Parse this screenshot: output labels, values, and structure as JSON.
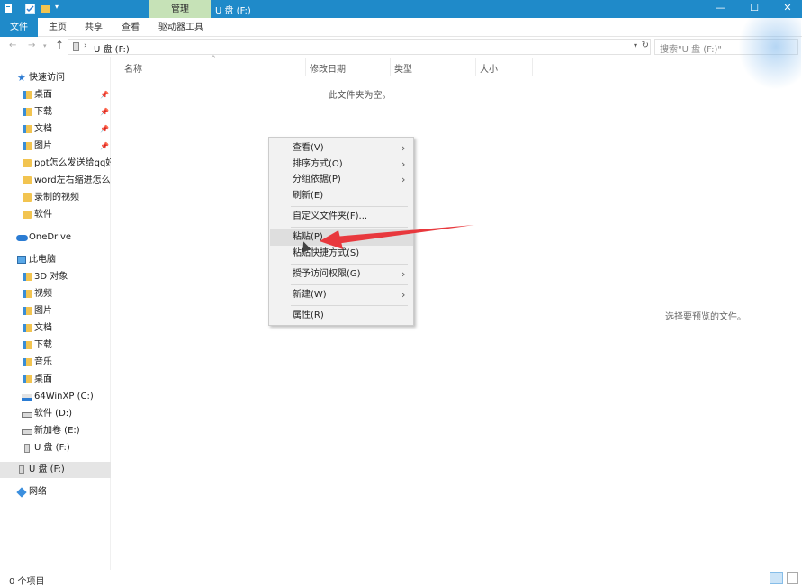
{
  "titlebar": {
    "manage_tab": "管理",
    "title": "U 盘 (F:)",
    "minimize": "—",
    "maximize": "☐",
    "close": "✕",
    "quick_access_dropdown": "▾"
  },
  "ribbon": {
    "tabs": [
      "文件",
      "主页",
      "共享",
      "查看",
      "驱动器工具"
    ]
  },
  "address": {
    "back": "←",
    "forward": "→",
    "history": "▾",
    "up": "↑",
    "chevron": "›",
    "path": "U 盘 (F:)",
    "dropdown": "▾",
    "refresh": "↻",
    "search_placeholder": "搜索\"U 盘 (F:)\""
  },
  "nav": {
    "items": [
      {
        "label": "快速访问",
        "icon": "star-icon"
      },
      {
        "label": "桌面",
        "icon": "folder-blue-icon",
        "pinned": "📌"
      },
      {
        "label": "下载",
        "icon": "download-folder-icon",
        "pinned": "📌"
      },
      {
        "label": "文档",
        "icon": "documents-folder-icon",
        "pinned": "📌"
      },
      {
        "label": "图片",
        "icon": "pictures-folder-icon",
        "pinned": "📌"
      },
      {
        "label": "ppt怎么发送给qq好",
        "icon": "folder-icon"
      },
      {
        "label": "word左右缩进怎么设",
        "icon": "folder-icon"
      },
      {
        "label": "录制的视频",
        "icon": "folder-icon"
      },
      {
        "label": "软件",
        "icon": "folder-icon"
      },
      {
        "label": "OneDrive",
        "icon": "cloud-icon"
      },
      {
        "label": "此电脑",
        "icon": "pc-icon"
      },
      {
        "label": "3D 对象",
        "icon": "3d-objects-icon"
      },
      {
        "label": "视频",
        "icon": "videos-folder-icon"
      },
      {
        "label": "图片",
        "icon": "pictures-folder-icon"
      },
      {
        "label": "文档",
        "icon": "documents-folder-icon"
      },
      {
        "label": "下载",
        "icon": "download-folder-icon"
      },
      {
        "label": "音乐",
        "icon": "music-folder-icon"
      },
      {
        "label": "桌面",
        "icon": "desktop-folder-icon"
      },
      {
        "label": "64WinXP  (C:)",
        "icon": "system-drive-icon"
      },
      {
        "label": "软件 (D:)",
        "icon": "drive-icon"
      },
      {
        "label": "新加卷 (E:)",
        "icon": "drive-icon"
      },
      {
        "label": "U 盘 (F:)",
        "icon": "usb-drive-icon"
      },
      {
        "label": "U 盘 (F:)",
        "icon": "usb-drive-icon"
      },
      {
        "label": "网络",
        "icon": "network-icon"
      }
    ]
  },
  "filelist": {
    "columns": [
      "名称",
      "修改日期",
      "类型",
      "大小"
    ],
    "sort_arrow": "^",
    "empty_message": "此文件夹为空。"
  },
  "preview": {
    "message": "选择要预览的文件。"
  },
  "status": {
    "item_count": "0 个项目"
  },
  "context_menu": {
    "items": [
      {
        "label": "查看(V)",
        "submenu": "›"
      },
      {
        "label": "排序方式(O)",
        "submenu": "›"
      },
      {
        "label": "分组依据(P)",
        "submenu": "›"
      },
      {
        "label": "刷新(E)"
      },
      {
        "label": "自定义文件夹(F)..."
      },
      {
        "label": "粘贴(P)",
        "highlighted": true
      },
      {
        "label": "粘贴快捷方式(S)"
      },
      {
        "label": "授予访问权限(G)",
        "submenu": "›"
      },
      {
        "label": "新建(W)",
        "submenu": "›"
      },
      {
        "label": "属性(R)"
      }
    ]
  },
  "colors": {
    "titlebar": "#1f8ac9",
    "manage_tab": "#c6e2b7",
    "annotation_arrow": "#e8383d",
    "menu_bg": "#f2f2f2",
    "menu_highlight": "#dedede"
  }
}
